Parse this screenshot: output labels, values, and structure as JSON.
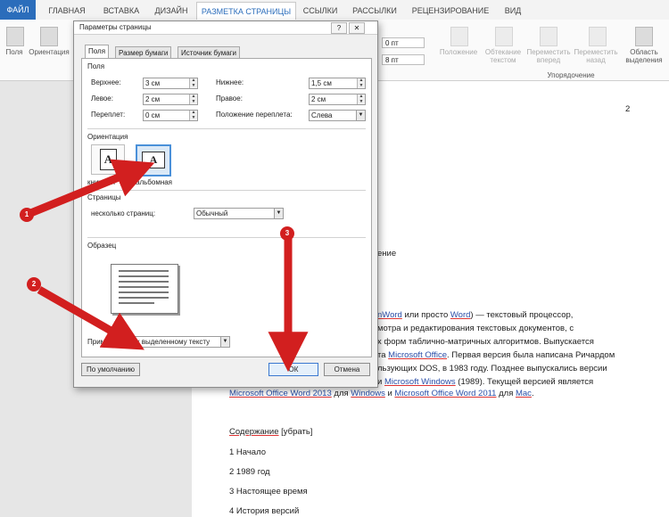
{
  "ribbon_tabs": [
    "ФАЙЛ",
    "ГЛАВНАЯ",
    "ВСТАВКА",
    "ДИЗАЙН",
    "РАЗМЕТКА СТРАНИЦЫ",
    "ССЫЛКИ",
    "РАССЫЛКИ",
    "РЕЦЕНЗИРОВАНИЕ",
    "ВИД"
  ],
  "ribbon": {
    "fields": "Поля",
    "orientation": "Ориентация",
    "spacing_before": "0 пт",
    "spacing_after": "8 пт",
    "position": "Положение",
    "wrap_text": "Обтекание текстом",
    "bring_forward": "Переместить вперед",
    "send_backward": "Переместить назад",
    "selection_pane": "Область выделения",
    "arrange_group": "Упорядочение"
  },
  "dialog": {
    "title": "Параметры страницы",
    "help": "?",
    "close": "✕",
    "tabs": [
      "Поля",
      "Размер бумаги",
      "Источник бумаги"
    ],
    "margins_section": "Поля",
    "top_label": "Верхнее:",
    "top_value": "3 см",
    "bottom_label": "Нижнее:",
    "bottom_value": "1,5 см",
    "left_label": "Левое:",
    "left_value": "2 см",
    "right_label": "Правое:",
    "right_value": "2 см",
    "gutter_label": "Переплет:",
    "gutter_value": "0 см",
    "gutter_pos_label": "Положение переплета:",
    "gutter_pos_value": "Слева",
    "orientation_section": "Ориентация",
    "portrait_label": "книжная",
    "landscape_label": "альбомная",
    "pages_section": "Страницы",
    "multiple_pages_label": "несколько страниц:",
    "multiple_pages_value": "Обычный",
    "preview_section": "Образец",
    "apply_label": "Применить:",
    "apply_value": "к выделенному тексту",
    "default_button": "По умолчанию",
    "ok_button": "ОК",
    "cancel_button": "Отмена"
  },
  "document": {
    "page_number": "2",
    "heading_tail": "ение",
    "para_line1_a": "nWord",
    "para_line1_b": " или просто ",
    "para_line1_c": "Word",
    "para_line1_d": ") — текстовый процессор,",
    "para_line2": "мотра и редактирования текстовых документов, с",
    "para_line3_a": "х форм таблично-матричных алгоритмов. Выпускается",
    "para_line4_a": "та ",
    "para_line4_b": "Microsoft Office",
    "para_line4_c": ". Первая версия была написана Ричардом",
    "para_line5": "льзующих DOS, в 1983 году. Позднее выпускались версии",
    "para_line6_a": "и ",
    "para_line6_b": "Microsoft Windows",
    "para_line6_c": " (1989). Текущей версией является",
    "para_line7_a": "Microsoft Office Word 2013",
    "para_line7_b": " для ",
    "para_line7_c": "Windows",
    "para_line7_d": " и ",
    "para_line7_e": "Microsoft Office Word 2011",
    "para_line7_f": " для ",
    "para_line7_g": "Mac",
    "para_line7_h": ".",
    "toc_title": "Содержание",
    "toc_hide": "[убрать]",
    "toc": [
      "1 Начало",
      "2 1989 год",
      "3 Настоящее время",
      "4 История версий"
    ]
  },
  "annotations": [
    "1",
    "2",
    "3"
  ],
  "colors": {
    "accent": "#2b6dbb",
    "arrow": "#d21f1f"
  }
}
